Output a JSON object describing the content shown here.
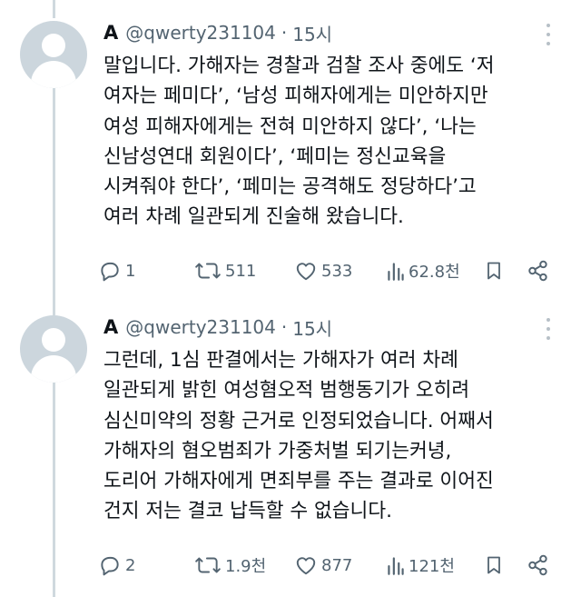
{
  "tweets": [
    {
      "name": "A",
      "handle": "@qwerty231104",
      "dot": "·",
      "time": "15시",
      "lines": [
        "말입니다. 가해자는 경찰과 검찰 조사 중에도 ‘저",
        "여자는 페미다’, ‘남성 피해자에게는 미안하지만",
        "여성 피해자에게는 전혀 미안하지 않다’, ‘나는",
        "신남성연대 회원이다’, ‘페미는 정신교육을",
        "시켜줘야 한다’, ‘페미는 공격해도 정당하다’고",
        "여러 차례 일관되게 진술해 왔습니다."
      ],
      "replies": "1",
      "retweets": "511",
      "likes": "533",
      "views": "62.8천"
    },
    {
      "name": "A",
      "handle": "@qwerty231104",
      "dot": "·",
      "time": "15시",
      "lines": [
        "그런데, 1심 판결에서는 가해자가 여러 차례",
        "일관되게 밝힌 여성혐오적 범행동기가 오히려",
        "심신미약의 정황 근거로 인정되었습니다. 어째서",
        "가해자의 혐오범죄가 가중처벌 되기는커녕,",
        "도리어 가해자에게 면죄부를 주는 결과로 이어진",
        "건지 저는 결코 납득할 수 없습니다."
      ],
      "replies": "2",
      "retweets": "1.9천",
      "likes": "877",
      "views": "121천"
    }
  ],
  "icons": {
    "reply": "reply-icon",
    "retweet": "retweet-icon",
    "like": "like-icon",
    "views": "views-icon",
    "bookmark": "bookmark-icon",
    "share": "share-icon",
    "more": "more-icon"
  },
  "colors": {
    "text": "#0f1419",
    "secondary": "#536471",
    "thread_line": "#cfd9de",
    "avatar_bg": "#ccd6dd"
  }
}
